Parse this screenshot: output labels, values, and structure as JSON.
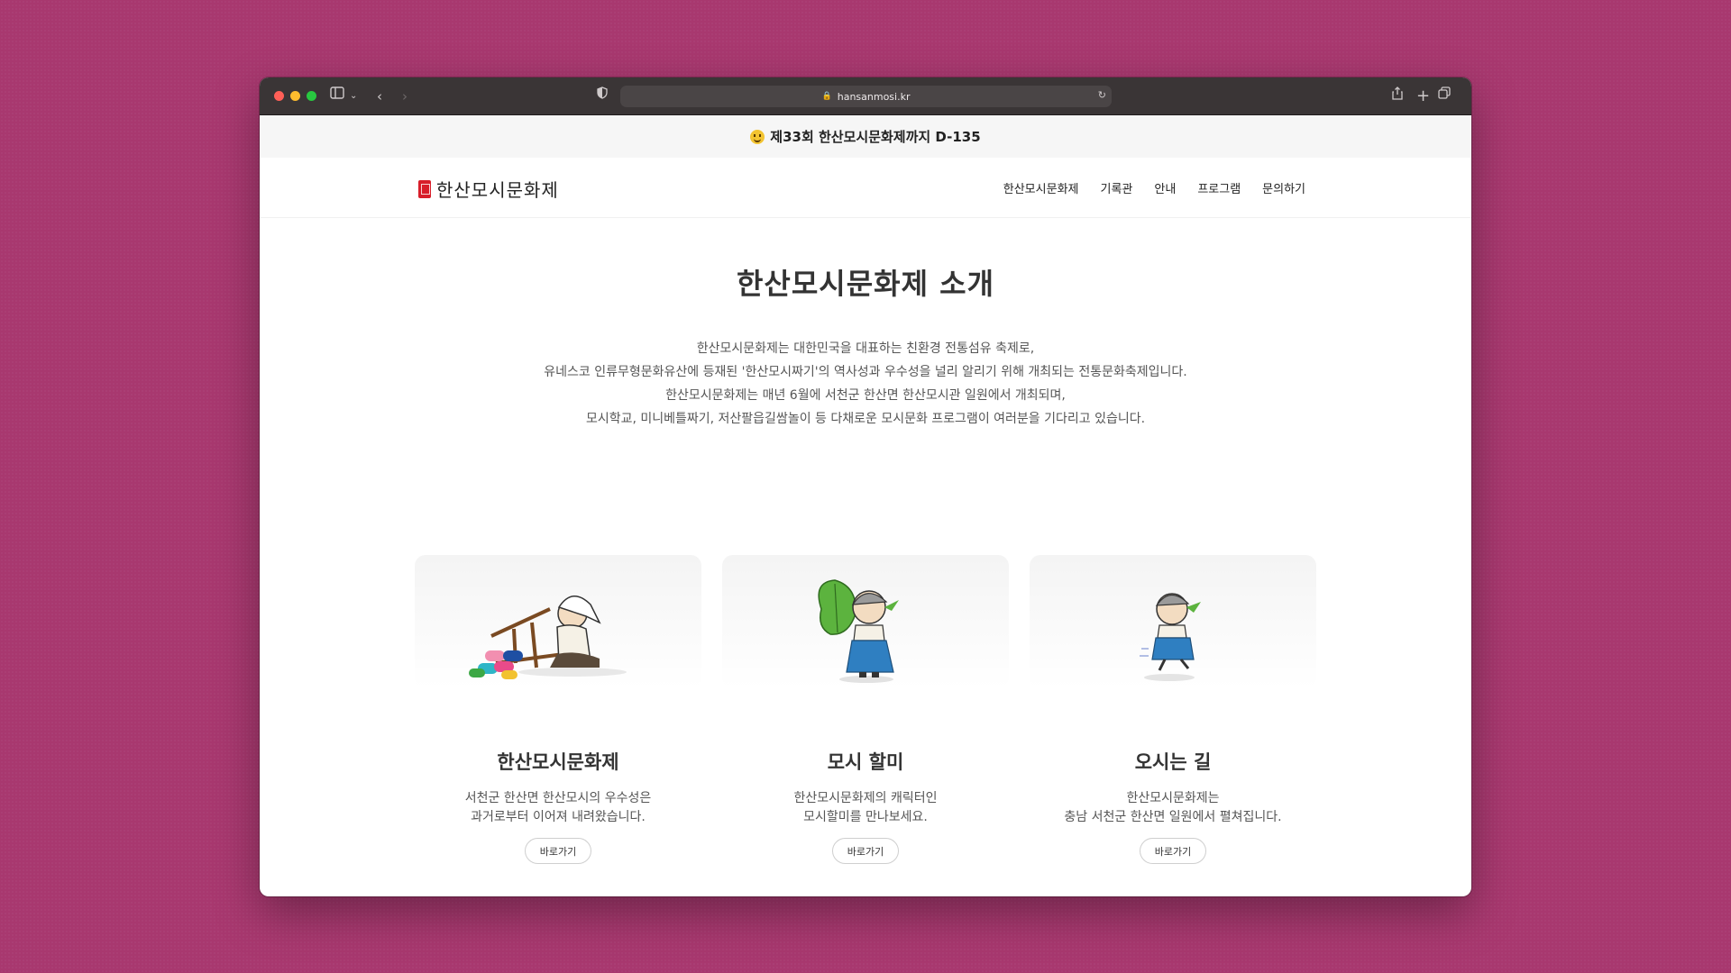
{
  "browser": {
    "url": "hansanmosi.kr"
  },
  "announcement": {
    "text": "제33회 한산모시문화제까지 D-135"
  },
  "header": {
    "logo_text": "한산모시문화제",
    "menu": [
      {
        "label": "한산모시문화제"
      },
      {
        "label": "기록관"
      },
      {
        "label": "안내"
      },
      {
        "label": "프로그램"
      },
      {
        "label": "문의하기"
      }
    ]
  },
  "hero": {
    "title": "한산모시문화제 소개",
    "lines": [
      "한산모시문화제는 대한민국을 대표하는 친환경 전통섬유 축제로,",
      "유네스코 인류무형문화유산에 등재된 '한산모시짜기'의 역사성과 우수성을 널리 알리기 위해 개최되는 전통문화축제입니다.",
      "한산모시문화제는 매년 6월에 서천군 한산면 한산모시관 일원에서 개최되며,",
      "모시학교, 미니베틀짜기, 저산팔읍길쌈놀이 등 다채로운 모시문화 프로그램이 여러분을 기다리고 있습니다."
    ]
  },
  "cards": [
    {
      "title": "한산모시문화제",
      "desc": "서천군 한산면 한산모시의 우수성은\n과거로부터 이어져 내려왔습니다.",
      "button": "바로가기"
    },
    {
      "title": "모시 할미",
      "desc": "한산모시문화제의 캐릭터인\n모시할미를 만나보세요.",
      "button": "바로가기"
    },
    {
      "title": "오시는 길",
      "desc": "한산모시문화제는\n충남 서천군 한산면 일원에서 펼쳐집니다.",
      "button": "바로가기"
    }
  ],
  "colors": {
    "background": "#a8386f",
    "logo_red": "#d81e2a",
    "toolbar": "#3a3536"
  }
}
